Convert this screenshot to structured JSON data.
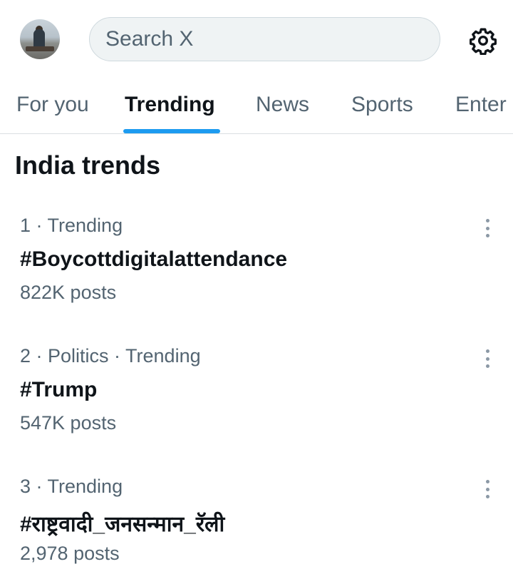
{
  "search": {
    "placeholder": "Search X"
  },
  "tabs": [
    {
      "label": "For you"
    },
    {
      "label": "Trending"
    },
    {
      "label": "News"
    },
    {
      "label": "Sports"
    },
    {
      "label": "Enter"
    }
  ],
  "section": {
    "title": "India trends"
  },
  "trends": [
    {
      "meta": "1 · Trending",
      "name": "#Boycottdigitalattendance",
      "posts": "822K posts"
    },
    {
      "meta": "2 · Politics · Trending",
      "name": "#Trump",
      "posts": "547K posts"
    },
    {
      "meta": "3 · Trending",
      "name": "#राष्ट्रवादी_जनसन्मान_रॅली",
      "posts": "2,978 posts"
    }
  ],
  "colors": {
    "accent": "#1d9bf0",
    "muted": "#536471",
    "text": "#0f1419"
  },
  "icons": {
    "settings": "gear-icon",
    "more": "more-vertical-icon"
  }
}
